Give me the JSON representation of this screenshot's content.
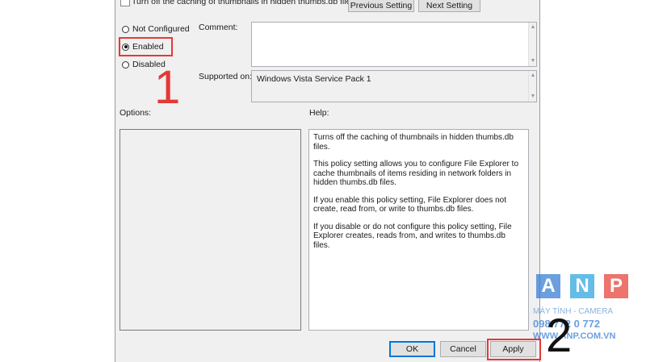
{
  "dialog": {
    "title": "Turn off the caching of thumbnails in hidden thumbs.db files",
    "previous_setting_label": "Previous Setting",
    "next_setting_label": "Next Setting",
    "options": {
      "not_configured_label": "Not Configured",
      "enabled_label": "Enabled",
      "disabled_label": "Disabled",
      "selected": "Enabled"
    },
    "comment_label": "Comment:",
    "comment_value": "",
    "supported_on_label": "Supported on:",
    "supported_on_value": "Windows Vista Service Pack 1",
    "options_section_label": "Options:",
    "help_section_label": "Help:",
    "help_paragraphs": [
      "Turns off the caching of thumbnails in hidden thumbs.db files.",
      "This policy setting allows you to configure File Explorer to cache thumbnails of items residing in network folders in hidden thumbs.db files.",
      "If you enable this policy setting, File Explorer does not create, read from, or write to thumbs.db files.",
      "If you disable or do not configure this policy setting, File Explorer creates, reads from, and writes to thumbs.db files."
    ],
    "ok_label": "OK",
    "cancel_label": "Cancel",
    "apply_label": "Apply"
  },
  "annotations": {
    "step1": "1",
    "step2": "2",
    "highlight_color": "#e53935"
  },
  "watermark": {
    "letters": [
      "A",
      "N",
      "P"
    ],
    "line1": "MÁY TÍNH - CAMERA",
    "line2": "098 772 0 772",
    "line3": "WWW.ANP.COM.VN",
    "colors": [
      "#3a7fd5",
      "#2fa8e0",
      "#e8453c"
    ]
  }
}
